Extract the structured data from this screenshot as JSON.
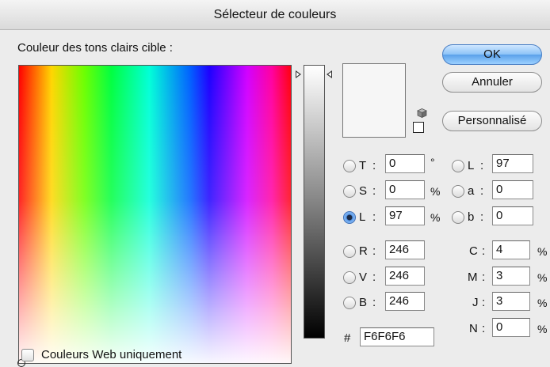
{
  "window": {
    "title": "Sélecteur de couleurs"
  },
  "target_label": "Couleur des tons clairs cible :",
  "buttons": {
    "ok": "OK",
    "cancel": "Annuler",
    "custom": "Personnalisé"
  },
  "preview": {
    "new_color": "#F6F6F6"
  },
  "hsb": {
    "h": {
      "label": "T",
      "value": "0",
      "unit": "°",
      "selected": false
    },
    "s": {
      "label": "S",
      "value": "0",
      "unit": "%",
      "selected": false
    },
    "b": {
      "label": "L",
      "value": "97",
      "unit": "%",
      "selected": true
    }
  },
  "lab": {
    "l": {
      "label": "L",
      "value": "97"
    },
    "a": {
      "label": "a",
      "value": "0"
    },
    "b": {
      "label": "b",
      "value": "0"
    }
  },
  "rgb": {
    "r": {
      "label": "R",
      "value": "246"
    },
    "g": {
      "label": "V",
      "value": "246"
    },
    "b": {
      "label": "B",
      "value": "246"
    }
  },
  "cmyk": {
    "c": {
      "label": "C",
      "value": "4",
      "unit": "%"
    },
    "m": {
      "label": "M",
      "value": "3",
      "unit": "%"
    },
    "y": {
      "label": "J",
      "value": "3",
      "unit": "%"
    },
    "k": {
      "label": "N",
      "value": "0",
      "unit": "%"
    }
  },
  "hex": {
    "label": "#",
    "value": "F6F6F6"
  },
  "web_only": {
    "label": "Couleurs Web uniquement",
    "checked": false
  },
  "separator": ":"
}
